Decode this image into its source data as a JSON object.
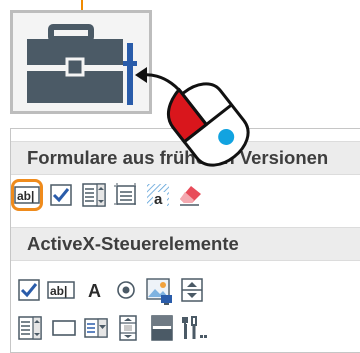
{
  "toolbar": {
    "icon": "toolbox-icon"
  },
  "panel": {
    "legacy_section": {
      "title": "Formulare aus früheren Versionen",
      "controls": [
        {
          "name": "text-field",
          "label": "ab|",
          "icon": "text-field-icon",
          "highlighted": true
        },
        {
          "name": "checkbox",
          "icon": "checkbox-icon"
        },
        {
          "name": "combo-box",
          "icon": "combo-box-icon"
        },
        {
          "name": "frame",
          "icon": "frame-icon"
        },
        {
          "name": "field-shading",
          "label": "a",
          "icon": "field-shading-icon"
        },
        {
          "name": "reset-field-shading",
          "icon": "eraser-icon"
        }
      ]
    },
    "activex_section": {
      "title": "ActiveX-Steuerelemente",
      "controls_row1": [
        {
          "name": "checkbox",
          "icon": "checkbox-icon"
        },
        {
          "name": "text-box",
          "label": "ab|",
          "icon": "text-box-icon"
        },
        {
          "name": "label",
          "label": "A",
          "icon": "label-icon"
        },
        {
          "name": "option-button",
          "icon": "option-button-icon"
        },
        {
          "name": "image",
          "icon": "image-icon"
        },
        {
          "name": "spin-button",
          "icon": "spin-button-icon"
        }
      ],
      "controls_row2": [
        {
          "name": "list-box",
          "icon": "list-box-icon"
        },
        {
          "name": "command-button",
          "icon": "command-button-icon"
        },
        {
          "name": "combo-box",
          "icon": "combo-box-icon"
        },
        {
          "name": "scroll-bar",
          "icon": "scroll-bar-icon"
        },
        {
          "name": "toggle-button",
          "icon": "toggle-button-icon"
        },
        {
          "name": "more-controls",
          "icon": "more-controls-icon"
        }
      ]
    }
  },
  "colors": {
    "highlight": "#ef8b1c",
    "icon_dark": "#4b5a66",
    "accent_blue": "#2a5caa",
    "mouse_button": "#d9161c",
    "mouse_dot": "#12a3e0"
  }
}
